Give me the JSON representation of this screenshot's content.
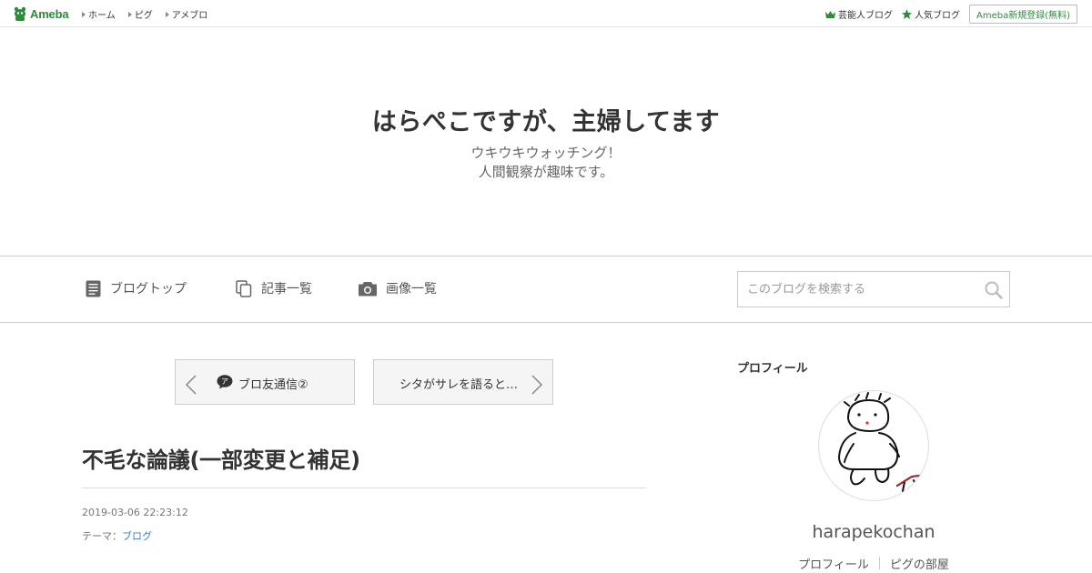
{
  "topbar": {
    "logo_text": "Ameba",
    "nav": [
      {
        "label": "ホーム"
      },
      {
        "label": "ピグ"
      },
      {
        "label": "アメブロ"
      }
    ],
    "right": {
      "celeb_label": "芸能人ブログ",
      "popular_label": "人気ブログ",
      "register_label": "Ameba新規登録(無料)"
    }
  },
  "header": {
    "title": "はらぺこですが、主婦してます",
    "desc_line1": "ウキウキウォッチング！",
    "desc_line2": "人間観察が趣味です。"
  },
  "navbar": {
    "top_label": "ブログトップ",
    "articles_label": "記事一覧",
    "images_label": "画像一覧",
    "search_placeholder": "このブログを検索する"
  },
  "article": {
    "prev_label": "ブロ友通信②",
    "next_label": "シタがサレを語ると…",
    "title": "不毛な論議(一部変更と補足)",
    "date": "2019-03-06 22:23:12",
    "theme_prefix": "テーマ：",
    "theme_link": "ブログ"
  },
  "sidebar": {
    "profile_heading": "プロフィール",
    "username": "harapekochan",
    "profile_link": "プロフィール",
    "pigg_link": "ピグの部屋"
  },
  "colors": {
    "brand_green": "#2d8c3c",
    "link_blue": "#3b7cc4"
  }
}
